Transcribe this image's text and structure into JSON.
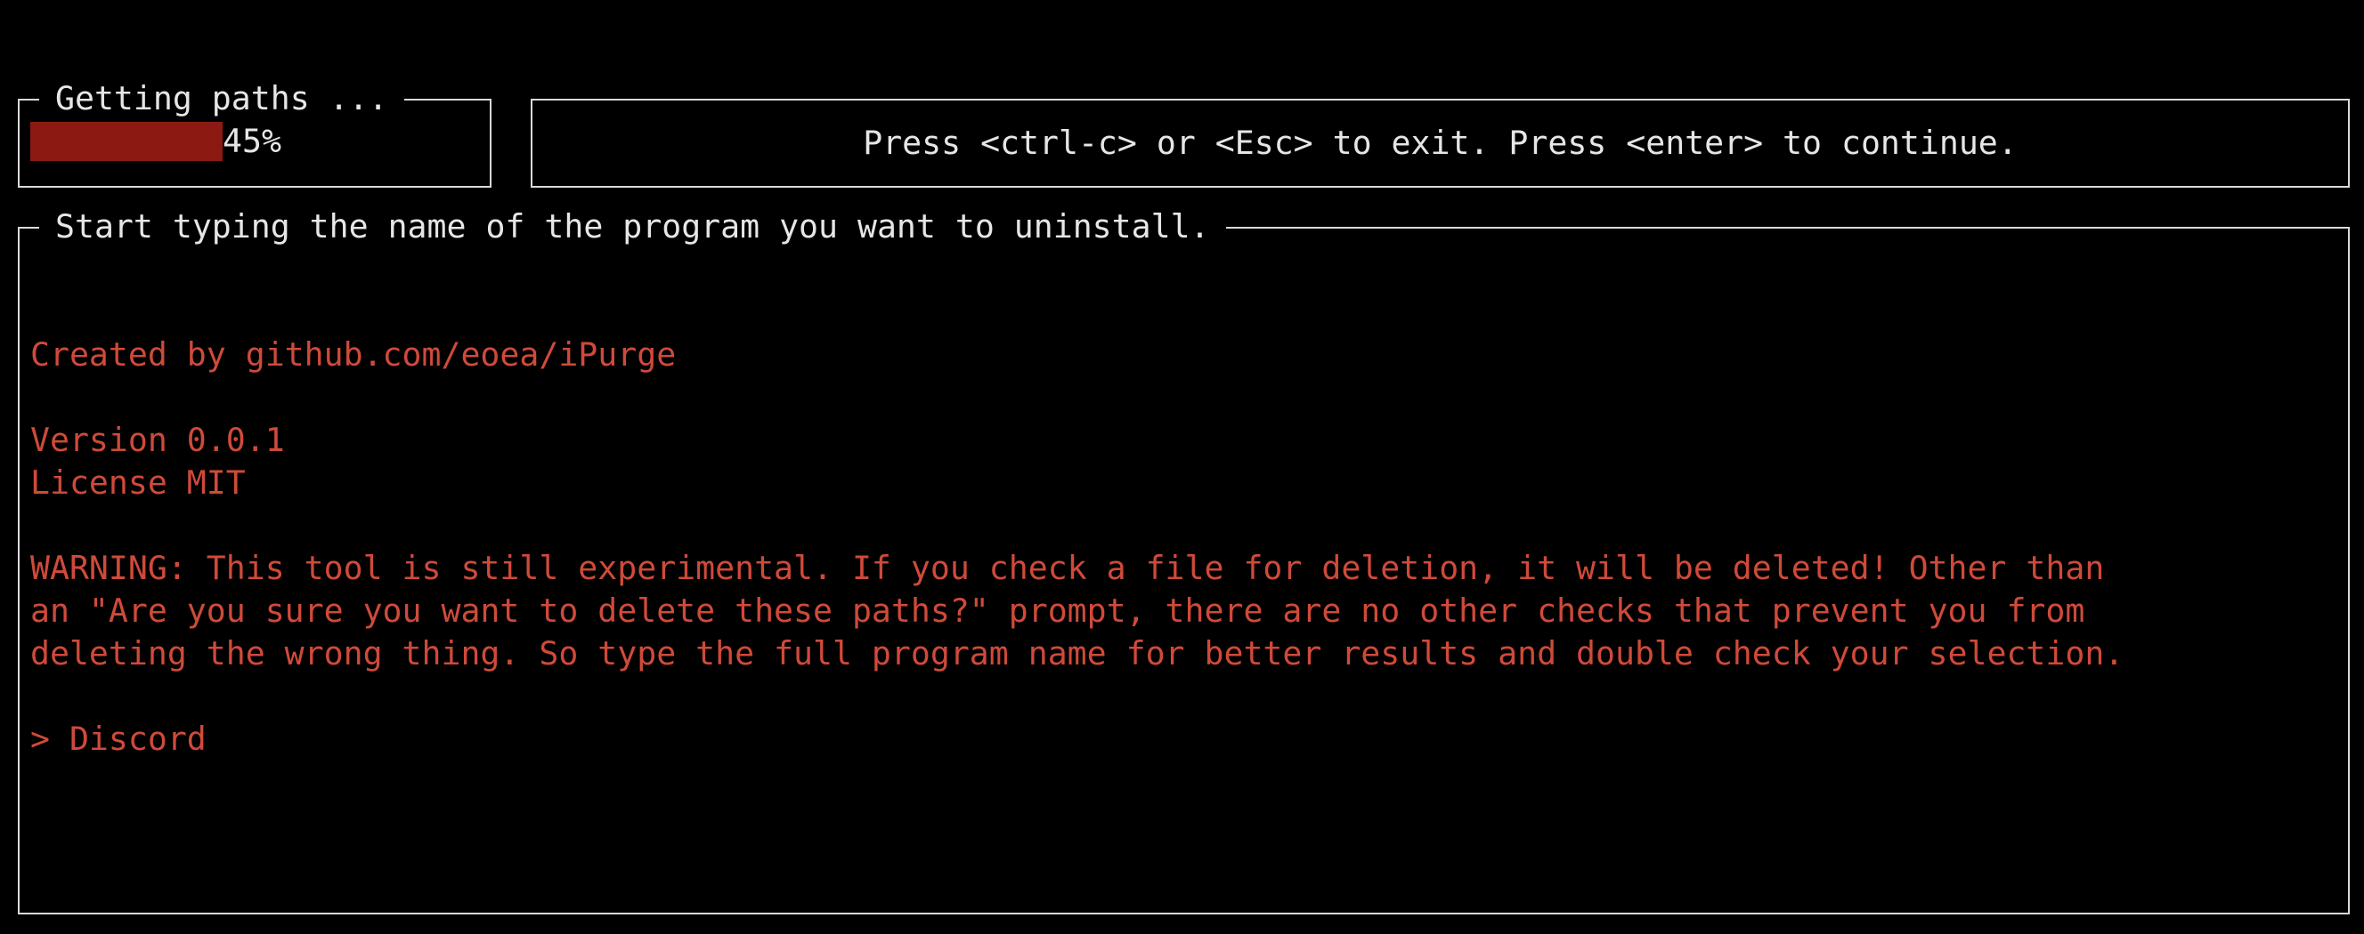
{
  "progress": {
    "title": "Getting paths ...",
    "percent_label": "45%",
    "fraction": 0.45,
    "bar_color": "#8c1a12"
  },
  "help": {
    "text": "Press <ctrl-c> or <Esc> to exit. Press <enter> to continue."
  },
  "main": {
    "title": "Start typing the name of the program you want to uninstall.",
    "credit": "Created by github.com/eoea/iPurge",
    "version": "Version 0.0.1",
    "license": "License MIT",
    "warning_lines": [
      "WARNING: This tool is still experimental. If you check a file for deletion, it will be deleted! Other than",
      "an \"Are you sure you want to delete these paths?\" prompt, there are no other checks that prevent you from",
      "deleting the wrong thing. So type the full program name for better results and double check your selection."
    ],
    "prompt": "> Discord",
    "text_color": "#cf4a3a"
  }
}
